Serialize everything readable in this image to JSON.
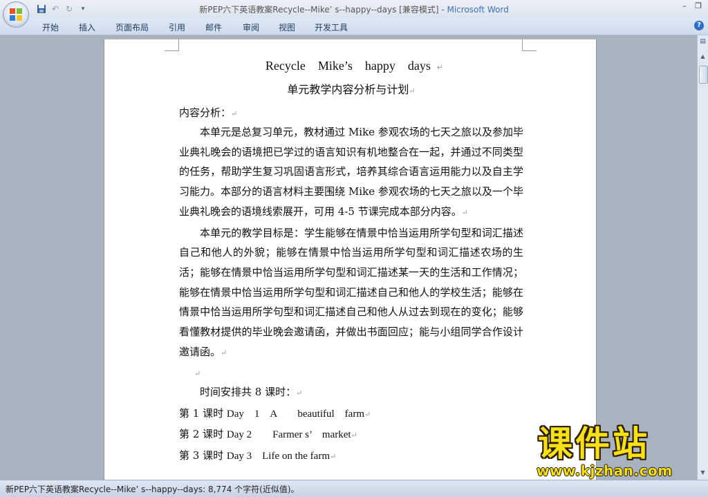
{
  "window": {
    "title": "新PEP六下英语教案Recycle--Mike’ s--happy--days [兼容模式] - ",
    "app_name": "Microsoft Word"
  },
  "ribbon": {
    "tabs": [
      "开始",
      "插入",
      "页面布局",
      "引用",
      "邮件",
      "审阅",
      "视图",
      "开发工具"
    ]
  },
  "document": {
    "title_words": [
      "Recycle",
      "Mike’s",
      "happy",
      "days"
    ],
    "subtitle": "单元教学内容分析与计划",
    "content_label": "内容分析：",
    "paragraph1": "本单元是总复习单元，教材通过 Mike 参观农场的七天之旅以及参加毕业典礼晚会的语境把已学过的语言知识有机地整合在一起，并通过不同类型的任务，帮助学生复习巩固语言形式，培养其综合语言运用能力以及自主学习能力。本部分的语言材料主要围绕 Mike 参观农场的七天之旅以及一个毕业典礼晚会的语境线索展开，可用 4-5 节课完成本部分内容。",
    "paragraph2": "本单元的教学目标是：学生能够在情景中恰当运用所学句型和词汇描述自己和他人的外貌；能够在情景中恰当运用所学句型和词汇描述农场的生活；能够在情景中恰当运用所学句型和词汇描述某一天的生活和工作情况；能够在情景中恰当运用所学句型和词汇描述自己和他人的学校生活；能够在情景中恰当运用所学句型和词汇描述自己和他人从过去到现在的变化；能够看懂教材提供的毕业晚会邀请函，并做出书面回应；能与小组同学合作设计邀请函。",
    "schedule_intro": "时间安排共 8 课时：",
    "schedule": [
      {
        "lesson": "第 1 课时",
        "text": "Day　1　A　　beautiful　farm"
      },
      {
        "lesson": "第 2 课时",
        "text": "Day 2　　Farmer s’　market"
      },
      {
        "lesson": "第 3 课时",
        "text": "Day 3　Life on the farm"
      }
    ],
    "para_mark": "↵"
  },
  "status_bar": {
    "text": "新PEP六下英语教案Recycle--Mike’ s--happy--days: 8,774 个字符(近似值)。"
  },
  "watermark": {
    "title": "课件站",
    "url": "www.kjzhan.com"
  },
  "icons": [
    "office-button-icon",
    "save-icon",
    "undo-icon",
    "redo-icon",
    "customize-qat-icon",
    "minimize-icon",
    "restore-icon",
    "help-icon",
    "scroll-up-icon",
    "scroll-down-icon"
  ]
}
